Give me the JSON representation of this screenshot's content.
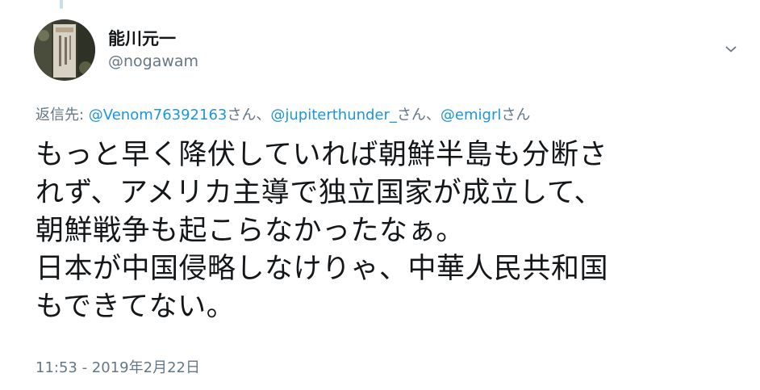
{
  "author": {
    "display_name": "能川元一",
    "handle": "@nogawam"
  },
  "reply_to": {
    "prefix": "返信先: ",
    "mentions": [
      {
        "handle": "@Venom76392163",
        "suffix": "さん、"
      },
      {
        "handle": "@jupiterthunder_",
        "suffix": "さん、"
      },
      {
        "handle": "@emigrl",
        "suffix": "さん"
      }
    ]
  },
  "tweet": {
    "lines": [
      "もっと早く降伏していれば朝鮮半島も分断さ",
      "れず、アメリカ主導で独立国家が成立して、",
      "朝鮮戦争も起こらなかったなぁ。",
      "日本が中国侵略しなけりゃ、中華人民共和国",
      "もできてない。"
    ]
  },
  "timestamp": "11:53 - 2019年2月22日",
  "icons": {
    "menu": "chevron-down-icon"
  },
  "colors": {
    "text": "#14171a",
    "secondary": "#657786",
    "link": "#1b95e0"
  }
}
